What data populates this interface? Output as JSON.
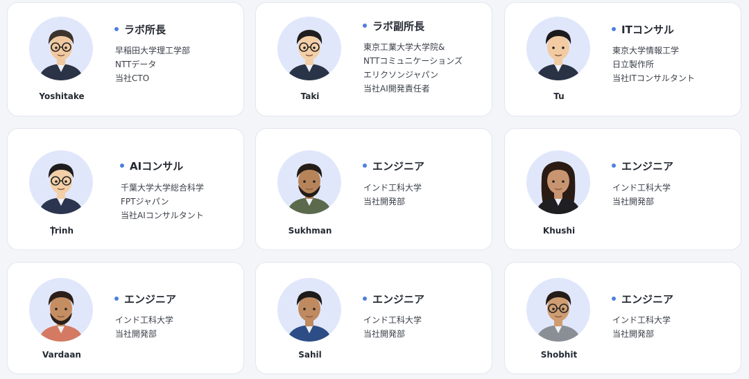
{
  "members": [
    {
      "name": "Yoshitake",
      "role": "ラボ所長",
      "details": [
        "早稲田大学理工学部",
        "NTTデータ",
        "当社CTO"
      ],
      "avatar_icon": "man-glasses-icon",
      "hair": "#3c342c",
      "skin": "#f1c9a0",
      "shirt": "#2b3346",
      "glasses": true
    },
    {
      "name": "Taki",
      "role": "ラボ副所長",
      "details": [
        "東京工業大学大学院&",
        "NTTコミュニケーションズ",
        "エリクソンジャパン",
        "当社AI開発責任者"
      ],
      "avatar_icon": "man-glasses-icon",
      "hair": "#1f1d1f",
      "skin": "#f3cfa8",
      "shirt": "#2a3448",
      "glasses": true
    },
    {
      "name": "Tu",
      "role": "ITコンサル",
      "details": [
        "東京大学情報工学",
        "日立製作所",
        "当社ITコンサルタント"
      ],
      "avatar_icon": "man-avatar-icon",
      "hair": "#1c1a1c",
      "skin": "#f2cba2",
      "shirt": "#2a3246",
      "glasses": false
    },
    {
      "name": "Trinh",
      "role": "AIコンサル",
      "details": [
        "千葉大学大学総合科学",
        "FPTジャパン",
        "当社AIコンサルタント"
      ],
      "avatar_icon": "man-glasses-icon",
      "hair": "#1e1c1e",
      "skin": "#f3cfa8",
      "shirt": "#2c3550",
      "glasses": true
    },
    {
      "name": "Sukhman",
      "role": "エンジニア",
      "details": [
        "インド工科大学",
        "当社開発部"
      ],
      "avatar_icon": "man-beard-icon",
      "hair": "#231c17",
      "skin": "#b7845a",
      "shirt": "#5b6a4c",
      "glasses": false
    },
    {
      "name": "Khushi",
      "role": "エンジニア",
      "details": [
        "インド工科大学",
        "当社開発部"
      ],
      "avatar_icon": "woman-avatar-icon",
      "hair": "#2a1b14",
      "skin": "#c99570",
      "shirt": "#1f1f22",
      "glasses": false
    },
    {
      "name": "Vardaan",
      "role": "エンジニア",
      "details": [
        "インド工科大学",
        "当社開発部"
      ],
      "avatar_icon": "man-beard-icon",
      "hair": "#2b1f18",
      "skin": "#c58e62",
      "shirt": "#d47a63",
      "glasses": false
    },
    {
      "name": "Sahil",
      "role": "エンジニア",
      "details": [
        "インド工科大学",
        "当社開発部"
      ],
      "avatar_icon": "man-avatar-icon",
      "hair": "#1c1a1a",
      "skin": "#bf8a60",
      "shirt": "#2d4d86",
      "glasses": false
    },
    {
      "name": "Shobhit",
      "role": "エンジニア",
      "details": [
        "インド工科大学",
        "当社開発部"
      ],
      "avatar_icon": "man-glasses-icon",
      "hair": "#241c18",
      "skin": "#cf9d72",
      "shirt": "#8a8f96",
      "glasses": true
    }
  ],
  "colors": {
    "accent_dot": "#4f7fdc",
    "avatar_bg": "#e1e7fb",
    "card_bg": "#ffffff",
    "page_bg": "#f3f5f9"
  }
}
